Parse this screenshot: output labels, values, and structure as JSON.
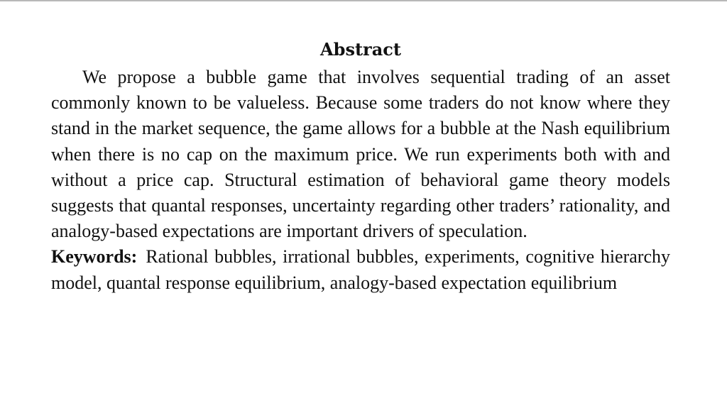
{
  "abstract": {
    "heading": "Abstract",
    "body": "We propose a bubble game that involves sequential trading of an asset commonly known to be valueless. Because some traders do not know where they stand in the market sequence, the game allows for a bubble at the Nash equilibrium when there is no cap on the maximum price. We run experiments both with and without a price cap. Structural estimation of behavioral game theory models suggests that quantal responses, uncertainty regarding other traders’ rationality, and analogy-based expectations are important drivers of speculation."
  },
  "keywords": {
    "label": "Keywords:",
    "text": "Rational bubbles, irrational bubbles, experiments, cognitive hierarchy model, quantal response equilibrium, analogy-based expectation equilibrium"
  }
}
